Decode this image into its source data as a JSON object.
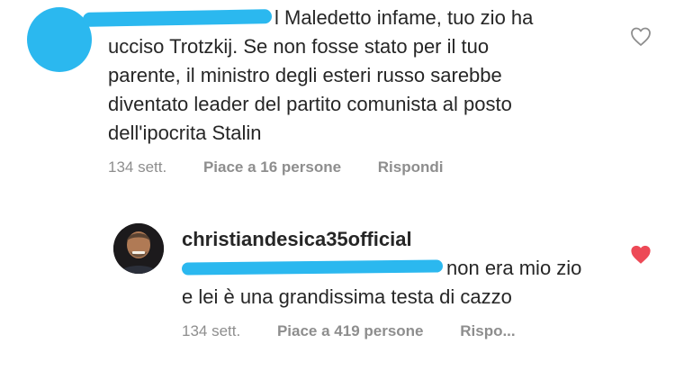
{
  "comments": [
    {
      "lines": [
        "l Maledetto infame, tuo zio ha",
        "ucciso Trotzkij. Se non fosse stato per il tuo",
        "parente, il ministro degli esteri russo sarebbe",
        "diventato leader del partito comunista al posto",
        "dell'ipocrita Stalin"
      ],
      "time": "134 sett.",
      "likes": "Piace a 16 persone",
      "reply": "Rispondi",
      "liked": false,
      "like_color": "#8e8e8e"
    },
    {
      "username": "christiandesica35official",
      "lines": [
        "non era mio zio",
        "e lei è una grandissima testa di cazzo"
      ],
      "time": "134 sett.",
      "likes": "Piace a 419 persone",
      "reply": "Rispo...",
      "liked": true,
      "like_color": "#ed4956"
    }
  ]
}
